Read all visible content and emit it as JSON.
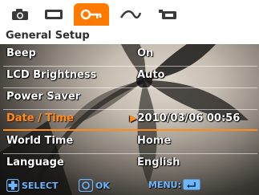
{
  "menu": {
    "tabs": [
      {
        "icon": "camera-icon",
        "active": false
      },
      {
        "icon": "video-camera-icon",
        "active": false
      },
      {
        "icon": "setup-key-icon",
        "active": true
      },
      {
        "icon": "connection-icon",
        "active": false
      },
      {
        "icon": "print-icon",
        "active": false
      }
    ],
    "section_title": "General Setup",
    "items": [
      {
        "label": "Beep",
        "value": "On"
      },
      {
        "label": "LCD Brightness",
        "value": "Auto"
      },
      {
        "label": "Power Saver",
        "value": ""
      },
      {
        "label": "Date / Time",
        "value": "2010/03/06 00:56",
        "selected": true
      },
      {
        "label": "World Time",
        "value": "Home"
      },
      {
        "label": "Language",
        "value": "English"
      }
    ]
  },
  "footer": {
    "select_label": "SELECT",
    "ok_label": "OK",
    "menu_label": "MENU:"
  },
  "colors": {
    "accent": "#ff7a00",
    "header_bg": "#ffffff",
    "footer_text": "#6ab6ff"
  }
}
